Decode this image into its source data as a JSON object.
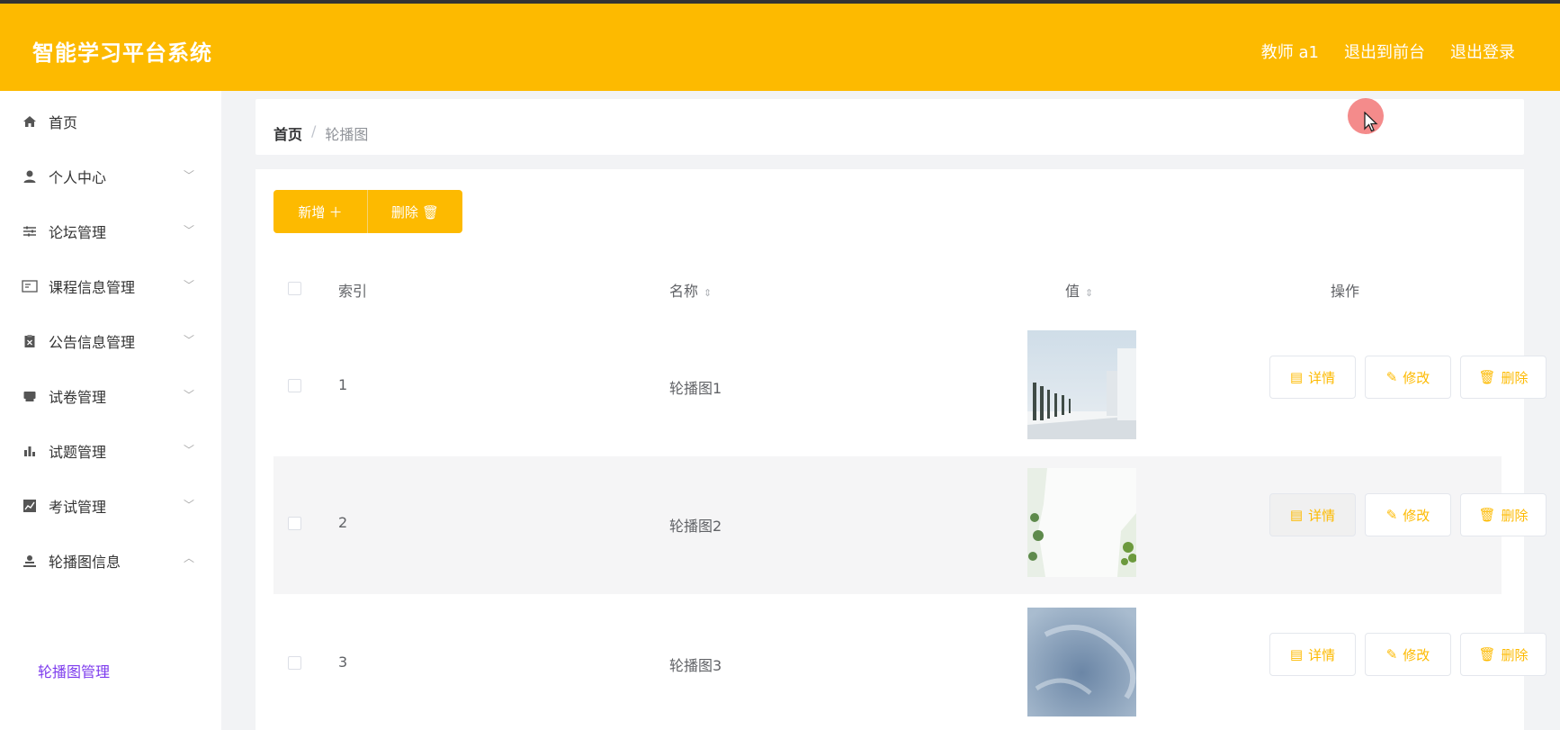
{
  "header": {
    "app_title": "智能学习平台系统",
    "nav": [
      "教师 a1",
      "退出到前台",
      "退出登录"
    ]
  },
  "sidebar": {
    "items": [
      {
        "label": "首页",
        "icon": "home-icon"
      },
      {
        "label": "个人中心",
        "icon": "user-icon"
      },
      {
        "label": "论坛管理",
        "icon": "sliders-icon"
      },
      {
        "label": "课程信息管理",
        "icon": "id-card-icon"
      },
      {
        "label": "公告信息管理",
        "icon": "clipboard-icon"
      },
      {
        "label": "试卷管理",
        "icon": "printer-icon"
      },
      {
        "label": "试题管理",
        "icon": "bar-chart-icon"
      },
      {
        "label": "考试管理",
        "icon": "line-chart-icon"
      },
      {
        "label": "轮播图信息",
        "icon": "person-icon"
      }
    ],
    "sub_item": "轮播图管理"
  },
  "breadcrumb": {
    "home": "首页",
    "separator": "/",
    "current": "轮播图"
  },
  "toolbar": {
    "add_label": "新增 ＋",
    "delete_label": "删除 🗑"
  },
  "table": {
    "headers": {
      "index": "索引",
      "name": "名称",
      "value": "值",
      "actions": "操作"
    },
    "rows": [
      {
        "index": "1",
        "name": "轮播图1"
      },
      {
        "index": "2",
        "name": "轮播图2"
      },
      {
        "index": "3",
        "name": "轮播图3"
      }
    ],
    "actions": {
      "detail": "详情",
      "edit": "修改",
      "delete": "删除"
    }
  },
  "colors": {
    "brand": "#fdba00",
    "sub_active": "#7c3aed"
  }
}
